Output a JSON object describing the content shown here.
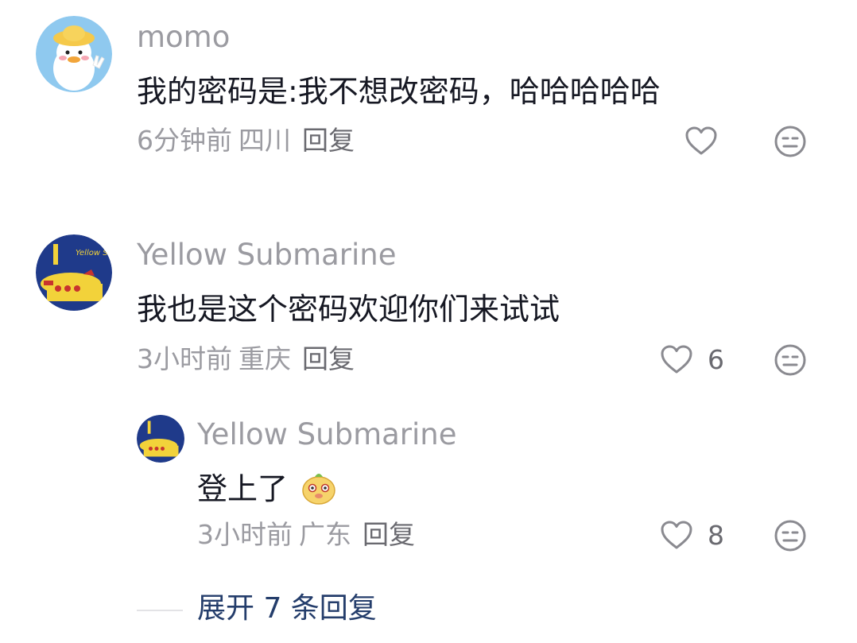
{
  "comments": [
    {
      "username": "momo",
      "text": "我的密码是:我不想改密码，哈哈哈哈哈",
      "time": "6分钟前",
      "location": "四川",
      "reply_label": "回复",
      "like_count": ""
    },
    {
      "username": "Yellow Submarine",
      "text": "我也是这个密码欢迎你们来试试",
      "time": "3小时前",
      "location": "重庆",
      "reply_label": "回复",
      "like_count": "6"
    }
  ],
  "reply": {
    "username": "Yellow Submarine",
    "text": "登上了",
    "time": "3小时前",
    "location": "广东",
    "reply_label": "回复",
    "like_count": "8"
  },
  "expand": {
    "label": "展开 7 条回复"
  },
  "avatar_logo_text": "Yellow Submarine",
  "colors": {
    "username": "#9b9ba1",
    "text": "#161823",
    "meta": "#9b9ba1",
    "expand": "#243d6b"
  },
  "icons": [
    "heart-outline-icon",
    "dislike-face-icon",
    "emoji-sticker-icon"
  ]
}
